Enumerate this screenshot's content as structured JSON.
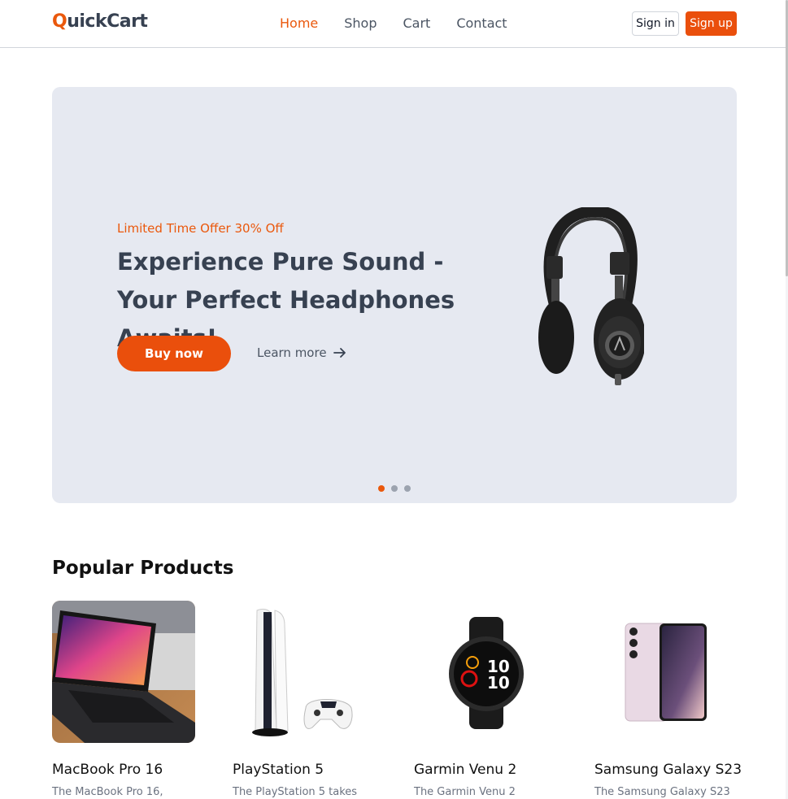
{
  "brand": {
    "first_letter": "Q",
    "rest": "uickCart",
    "accent_color": "#ea580c"
  },
  "nav": {
    "items": [
      {
        "label": "Home",
        "active": true
      },
      {
        "label": "Shop",
        "active": false
      },
      {
        "label": "Cart",
        "active": false
      },
      {
        "label": "Contact",
        "active": false
      }
    ]
  },
  "auth": {
    "sign_in": "Sign in",
    "sign_up": "Sign up"
  },
  "hero": {
    "offer": "Limited Time Offer 30% Off",
    "headline": "Experience Pure Sound - Your Perfect Headphones Awaits!",
    "buy_label": "Buy now",
    "learn_label": "Learn more",
    "image_icon": "headphones-image",
    "slides": 3,
    "active_slide": 1
  },
  "popular": {
    "title": "Popular Products",
    "products": [
      {
        "name": "MacBook Pro 16",
        "desc": "The MacBook Pro 16,",
        "icon": "laptop-image"
      },
      {
        "name": "PlayStation 5",
        "desc": "The PlayStation 5 takes",
        "icon": "console-image"
      },
      {
        "name": "Garmin Venu 2",
        "desc": "The Garmin Venu 2",
        "icon": "watch-image"
      },
      {
        "name": "Samsung Galaxy S23",
        "desc": "The Samsung Galaxy S23",
        "icon": "phone-image"
      }
    ]
  }
}
